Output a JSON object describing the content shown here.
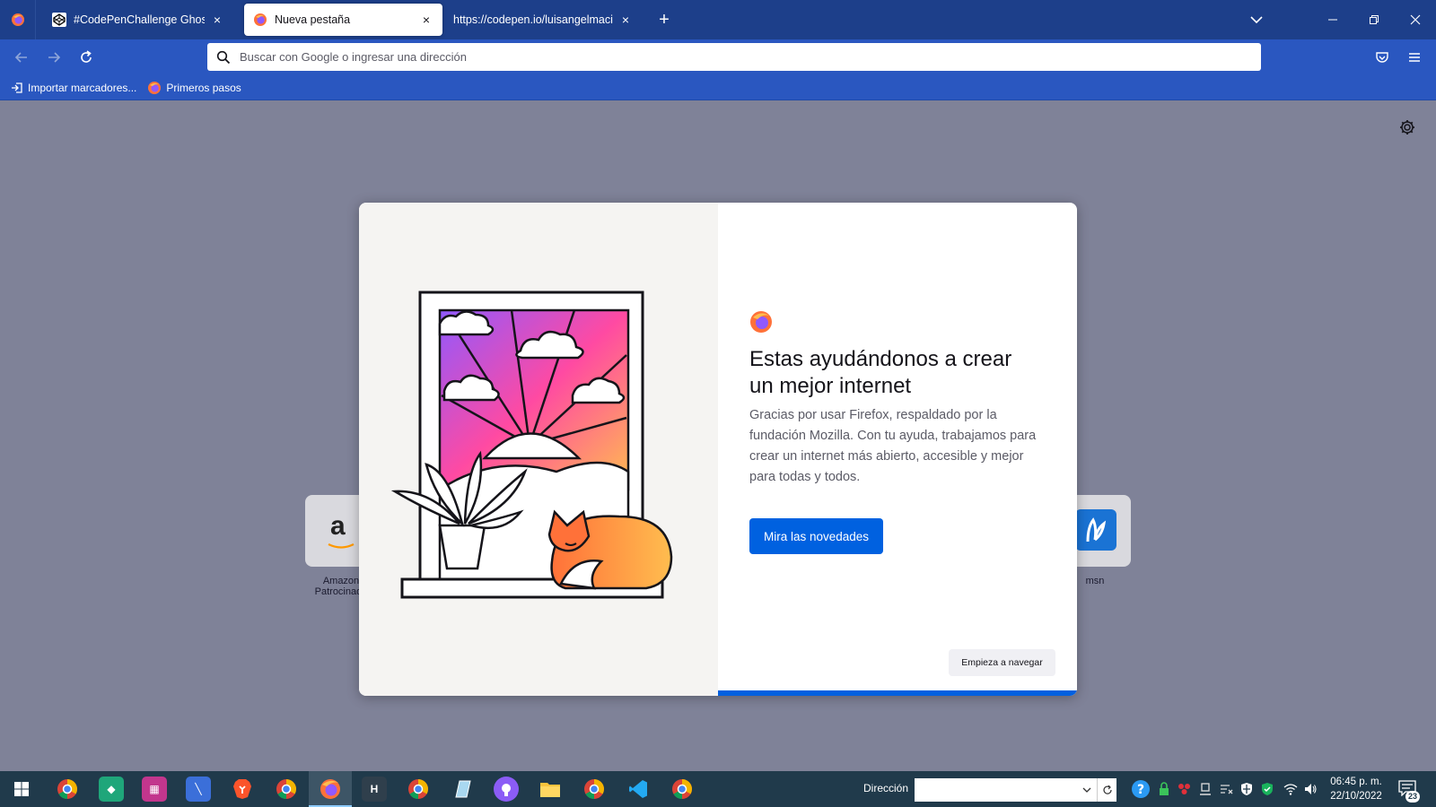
{
  "browser": {
    "tabs": [
      {
        "label": "#CodePenChallenge Ghosts 👻",
        "close": "×"
      },
      {
        "label": "Nueva pestaña",
        "close": "×"
      },
      {
        "label": "https://codepen.io/luisangelmaciel",
        "close": "×"
      }
    ],
    "new_tab_label": "+",
    "window_controls": {
      "minimize": "—",
      "restore": "❐",
      "close": "✕"
    }
  },
  "navbar": {
    "url_placeholder": "Buscar con Google o ingresar una dirección",
    "icons": [
      "back-arrow-icon",
      "forward-arrow-icon",
      "reload-icon",
      "search-icon",
      "pocket-icon",
      "hamburger-menu-icon"
    ]
  },
  "bookmarks": [
    {
      "label": "Importar marcadores..."
    },
    {
      "label": "Primeros pasos"
    }
  ],
  "shortcuts": [
    {
      "label": "Amazon",
      "sublabel": "Patrocinado"
    },
    {
      "label": "msn"
    }
  ],
  "modal": {
    "title": "Estas ayudándonos a crear un mejor internet",
    "description": "Gracias por usar Firefox, respaldado por la fundación Mozilla. Con tu ayuda, trabajamos para crear un internet más abierto, accesible y mejor para todas y todos.",
    "primary_button": "Mira las novedades",
    "secondary_button": "Empieza a navegar",
    "progress": 1.0
  },
  "taskbar": {
    "address_label": "Dirección",
    "address_value": "",
    "clock_time": "06:45 p. m.",
    "clock_date": "22/10/2022",
    "notifications": "23"
  },
  "colors": {
    "tabstrip": "#1d3f8a",
    "toolbar": "#2a57c0",
    "content_bg": "#7f8298",
    "primary": "#0061e0",
    "taskbar": "#203a4b"
  }
}
